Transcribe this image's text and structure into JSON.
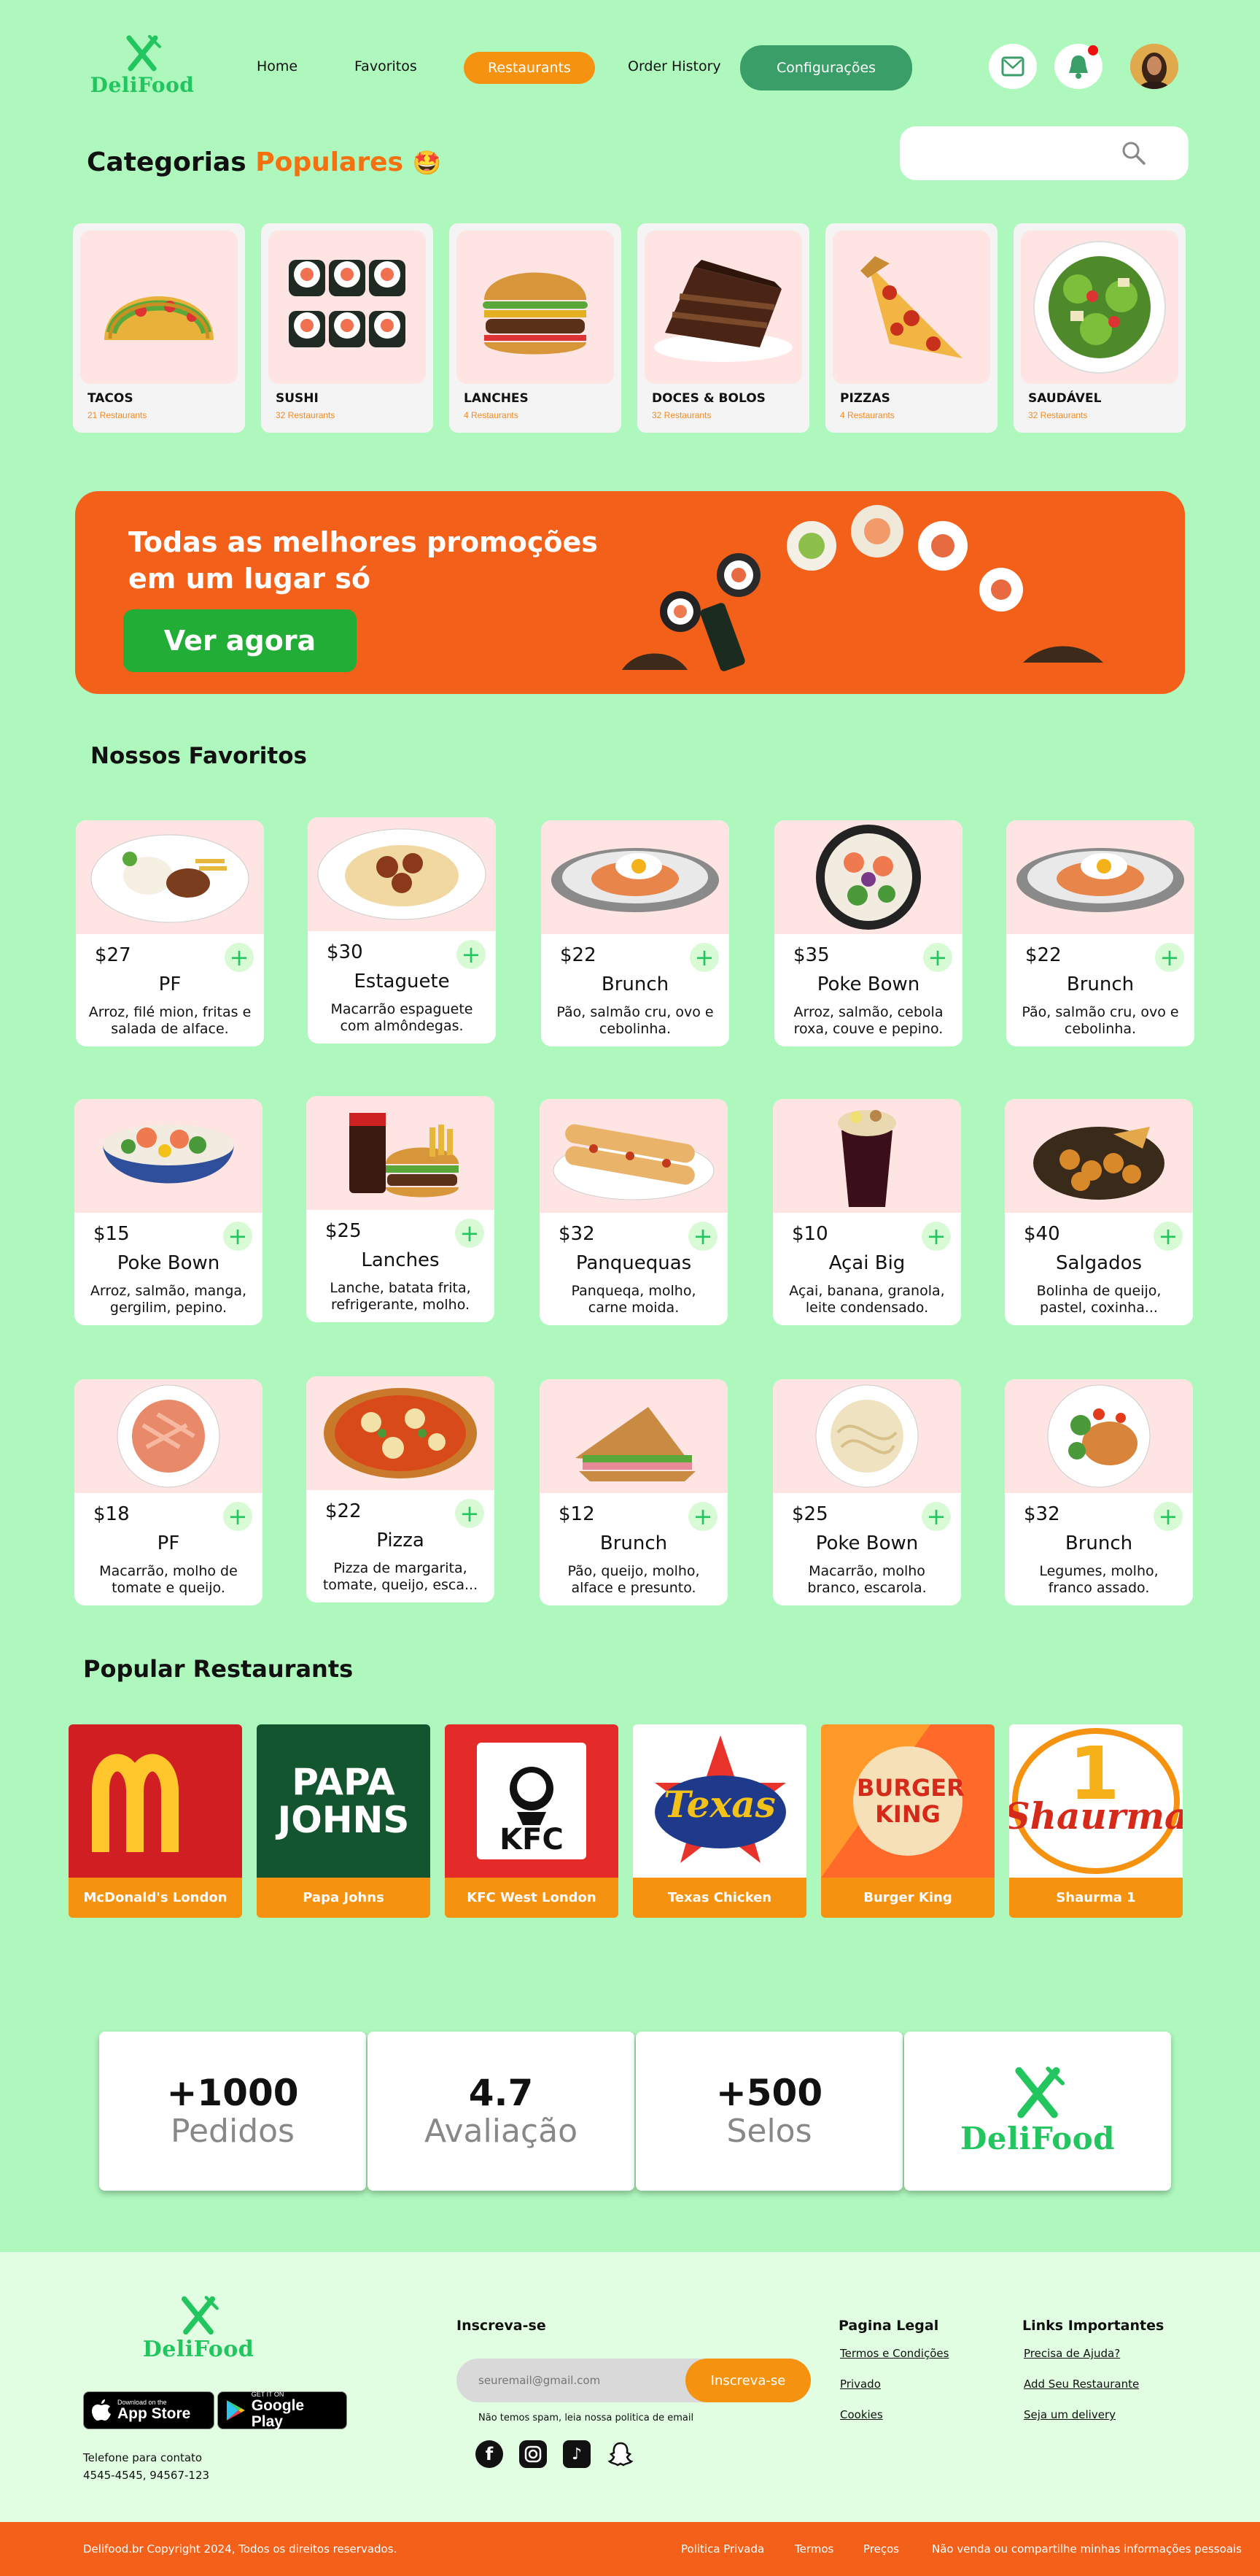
{
  "brand": {
    "name": "DeliFood",
    "color": "#22c55e"
  },
  "nav": {
    "home": "Home",
    "favorites": "Favoritos",
    "restaurants": "Restaurants",
    "order_history": "Order History",
    "settings": "Configurações"
  },
  "categories": {
    "title_part1": "Categorias",
    "title_part2": "Populares",
    "emoji": "🤩",
    "items": [
      {
        "name": "TACOS",
        "count": "21 Restaurants"
      },
      {
        "name": "SUSHI",
        "count": "32 Restaurants"
      },
      {
        "name": "LANCHES",
        "count": "4 Restaurants"
      },
      {
        "name": "DOCES & BOLOS",
        "count": "32 Restaurants"
      },
      {
        "name": "PIZZAS",
        "count": "4 Restaurants"
      },
      {
        "name": "SAUDÁVEL",
        "count": "32 Restaurants"
      }
    ]
  },
  "banner": {
    "line1": "Todas as melhores promoções",
    "line2": "em um lugar só",
    "cta": "Ver agora"
  },
  "favorites": {
    "title": "Nossos Favoritos",
    "items": [
      {
        "price": "$27",
        "title": "PF",
        "desc": "Arroz, filé mion, fritas e salada de alface."
      },
      {
        "price": "$30",
        "title": "Estaguete",
        "desc": "Macarrão espaguete com almôndegas."
      },
      {
        "price": "$22",
        "title": "Brunch",
        "desc": "Pão, salmão cru, ovo e cebolinha."
      },
      {
        "price": "$35",
        "title": "Poke Bown",
        "desc": "Arroz, salmão, cebola roxa, couve e pepino."
      },
      {
        "price": "$22",
        "title": "Brunch",
        "desc": "Pão, salmão cru, ovo e cebolinha."
      },
      {
        "price": "$15",
        "title": "Poke Bown",
        "desc": "Arroz, salmão, manga, gergilim, pepino."
      },
      {
        "price": "$25",
        "title": "Lanches",
        "desc": "Lanche, batata frita, refrigerante, molho."
      },
      {
        "price": "$32",
        "title": "Panquequas",
        "desc": "Panqueqa, molho, carne moida."
      },
      {
        "price": "$10",
        "title": "Açai Big",
        "desc": "Açai, banana, granola, leite condensado."
      },
      {
        "price": "$40",
        "title": "Salgados",
        "desc": "Bolinha de queijo, pastel, coxinha..."
      },
      {
        "price": "$18",
        "title": "PF",
        "desc": "Macarrão, molho de tomate e queijo."
      },
      {
        "price": "$22",
        "title": "Pizza",
        "desc": "Pizza de margarita, tomate, queijo, esca..."
      },
      {
        "price": "$12",
        "title": "Brunch",
        "desc": "Pão, queijo, molho, alface e presunto."
      },
      {
        "price": "$25",
        "title": "Poke Bown",
        "desc": "Macarrão, molho branco, escarola."
      },
      {
        "price": "$32",
        "title": "Brunch",
        "desc": "Legumes, molho, franco assado."
      }
    ]
  },
  "restaurants": {
    "title": "Popular Restaurants",
    "items": [
      {
        "name": "McDonald's London",
        "logo_text": "M"
      },
      {
        "name": "Papa Johns",
        "logo_text": "PAPA JOHNS"
      },
      {
        "name": "KFC West London",
        "logo_text": "KFC"
      },
      {
        "name": "Texas Chicken",
        "logo_text": "Texas"
      },
      {
        "name": "Burger King",
        "logo_text": "BURGER KING"
      },
      {
        "name": "Shaurma 1",
        "logo_text": "Shaurma"
      }
    ]
  },
  "stats": [
    {
      "value": "+1000",
      "label": "Pedidos"
    },
    {
      "value": "4.7",
      "label": "Avaliação"
    },
    {
      "value": "+500",
      "label": "Selos"
    }
  ],
  "footer": {
    "app_store_small": "Download on the",
    "app_store": "App Store",
    "google_small": "GET IT ON",
    "google": "Google Play",
    "contact_label": "Telefone para contato",
    "contact_numbers": "4545-4545,  94567-123",
    "subscribe_title": "Inscreva-se",
    "email_placeholder": "seuremail@gmail.com",
    "subscribe_button": "Inscreva-se",
    "spam_note": "Não temos spam, leia nossa politica de email",
    "legal_title": "Pagina Legal",
    "legal_links": [
      "Termos e Condições",
      "Privado",
      "Cookies"
    ],
    "important_title": "Links Importantes",
    "important_links": [
      "Precisa de Ajuda?",
      "Add Seu Restaurante",
      "Seja um delivery"
    ]
  },
  "bottom": {
    "copyright": "Delifood.br Copyright 2024, Todos os direitos reservados.",
    "links": [
      "Politica Privada",
      "Termos",
      "Preços",
      "Não venda ou compartilhe minhas informações pessoais"
    ]
  },
  "colors": {
    "bg": "#aef7bd",
    "accent": "#f2601a",
    "pill_orange": "#f5920f",
    "pill_green": "#3a9e68"
  }
}
